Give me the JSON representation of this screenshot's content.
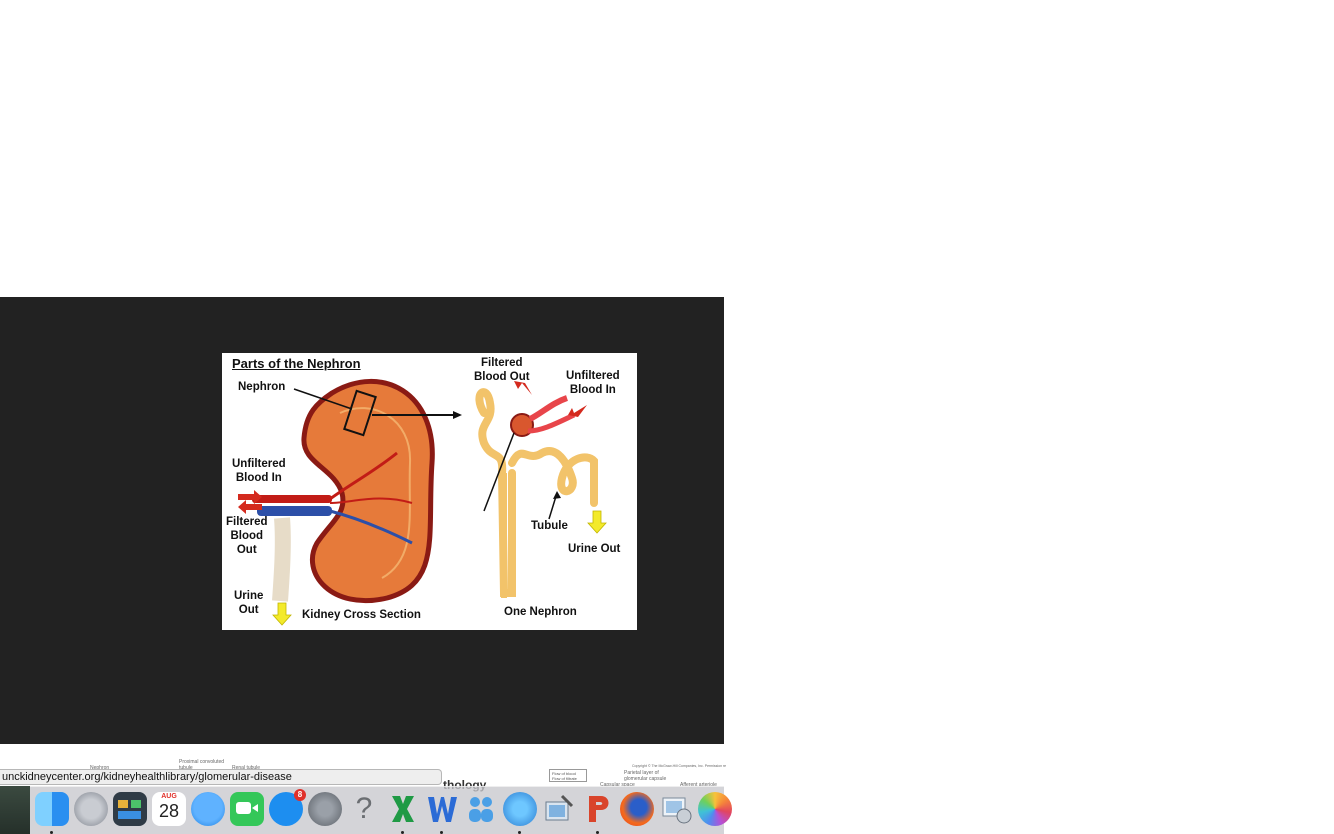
{
  "figure": {
    "title": "Parts of the Nephron",
    "labels": {
      "nephron": "Nephron",
      "unfiltered_left": "Unfiltered\nBlood In",
      "filtered_left": "Filtered\nBlood\nOut",
      "urine_left": "Urine\nOut",
      "kidney_caption": "Kidney Cross Section",
      "filtered_top": "Filtered\nBlood Out",
      "unfiltered_right": "Unfiltered\nBlood In",
      "tubule": "Tubule",
      "urine_right": "Urine Out",
      "nephron_caption": "One Nephron"
    }
  },
  "background_page": {
    "heading_fragment": "thology",
    "small_labels": [
      "Nephron",
      "Proximal convoluted\ntubule",
      "Renal tubule",
      "Flow of blood\nFlow of filtrate",
      "Parietal layer of\nglomerular capsule",
      "Copyright © The McGraw-Hill Companies, Inc. Permission re",
      "Capsular space",
      "Afferent arteriole"
    ]
  },
  "status_bar": {
    "url": "unckidneycenter.org/kidneyhealthlibrary/glomerular-disease"
  },
  "dock": {
    "calendar": {
      "month": "AUG",
      "day": "28"
    },
    "appstore_badge": "8",
    "help_glyph": "?",
    "items": [
      "finder-icon",
      "launchpad-icon",
      "mission-control-icon",
      "calendar-icon",
      "messages-icon",
      "facetime-icon",
      "app-store-icon",
      "system-preferences-icon",
      "help-icon",
      "excel-icon",
      "word-icon",
      "contacts-icon",
      "network-icon",
      "preview-icon",
      "powerpoint-icon",
      "firefox-icon",
      "image-capture-icon",
      "photos-icon"
    ],
    "colors": {
      "dock_bg": "#c8c8cd",
      "viewer_bg": "#222222",
      "artery_red": "#d42a1e",
      "vein_blue": "#2c4fa8",
      "kidney_orange": "#e67a3a",
      "arrow_yellow": "#f3ea2a"
    }
  }
}
